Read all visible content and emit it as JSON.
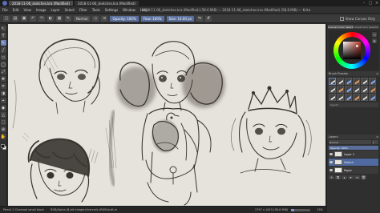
{
  "window": {
    "tabs": [
      "2018-11-06_sketches.kra (Modified)",
      "2018-11-06_sketches.kra (Modified)"
    ]
  },
  "menubar": {
    "items": [
      "File",
      "Edit",
      "View",
      "Image",
      "Layer",
      "Select",
      "Filter",
      "Tools",
      "Settings",
      "Window",
      "Help"
    ],
    "document_title": "2018-11-06_sketches.kra (Modified) (58.6 MiB) — 2018-11-06_sketches.kra (Modified) (58.6 MiB) — Krita"
  },
  "tool_options": {
    "blend_mode": "Normal",
    "opacity": "Opacity: 100%",
    "flow": "Flow: 100%",
    "size": "Size: 14.00 px",
    "show_canvas_only": "Show Canvas Only"
  },
  "dockers": {
    "tabs": [
      "Advanced Color Selector",
      "Small Color Selector"
    ],
    "brush_presets_title": "Brush Presets",
    "brush_filter": "Search",
    "layers_title": "Layers",
    "blend_mode": "Normal",
    "opacity": "Opacity: 100%",
    "layers": [
      {
        "name": "Layer 1"
      },
      {
        "name": "Sketch"
      },
      {
        "name": "Paper"
      }
    ]
  },
  "status": {
    "tool": "Pencil-2 Charcoal small block",
    "color_info": "RGB/Alpha (8-bit integer/channel) sRGB-built-in",
    "size": "2797 x 1615 (58.6 MiB)",
    "zoom": "15%",
    "zoom_fraction": 0.15
  },
  "colors": {
    "canvas": "#e6e2dc",
    "accent": "#5a6f9c",
    "pencil": "#3a3530"
  }
}
